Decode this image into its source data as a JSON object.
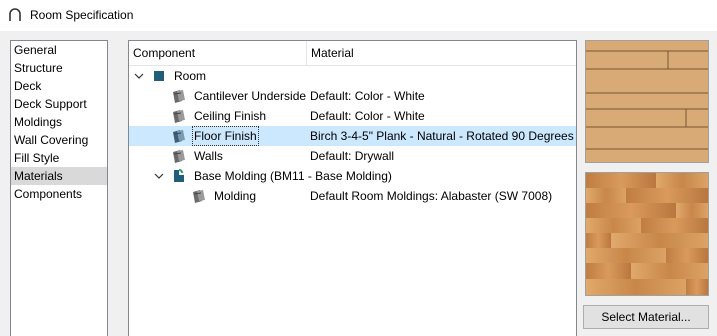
{
  "window": {
    "title": "Room Specification",
    "icon": "archway-icon"
  },
  "nav": {
    "items": [
      {
        "label": "General",
        "selected": false
      },
      {
        "label": "Structure",
        "selected": false
      },
      {
        "label": "Deck",
        "selected": false
      },
      {
        "label": "Deck Support",
        "selected": false
      },
      {
        "label": "Moldings",
        "selected": false
      },
      {
        "label": "Wall Covering",
        "selected": false
      },
      {
        "label": "Fill Style",
        "selected": false
      },
      {
        "label": "Materials",
        "selected": true
      },
      {
        "label": "Components",
        "selected": false
      }
    ]
  },
  "tree": {
    "headers": {
      "component": "Component",
      "material": "Material"
    },
    "rows": [
      {
        "component": "Room",
        "material": "",
        "expanded": true,
        "icon": "room-square-icon"
      },
      {
        "component": "Cantilever Underside",
        "material": "Default: Color - White",
        "icon": "material-swatch-icon"
      },
      {
        "component": "Ceiling Finish",
        "material": "Default: Color - White",
        "icon": "material-swatch-icon"
      },
      {
        "component": "Floor Finish",
        "material": "Birch 3-4-5\" Plank - Natural - Rotated 90 Degrees",
        "selected": true,
        "icon": "material-swatch-icon"
      },
      {
        "component": "Walls",
        "material": "Default: Drywall",
        "icon": "material-swatch-icon"
      },
      {
        "component": "Base Molding (BM11 - Base Molding)",
        "material": "",
        "expanded": true,
        "icon": "molding-profile-icon"
      },
      {
        "component": "Molding",
        "material": "Default Room Moldings: Alabaster (SW 7008)",
        "icon": "material-swatch-icon"
      }
    ]
  },
  "preview": {
    "plank_pattern": "plank-pattern-preview",
    "wood_texture": "wood-texture-preview"
  },
  "buttons": {
    "select_material": "Select Material..."
  },
  "colors": {
    "selection": "#cce8ff",
    "nav_selection": "#d9d9d9",
    "room_icon": "#1f5f7a",
    "plank": "#d8aa76",
    "wood": "#c98b4f"
  }
}
